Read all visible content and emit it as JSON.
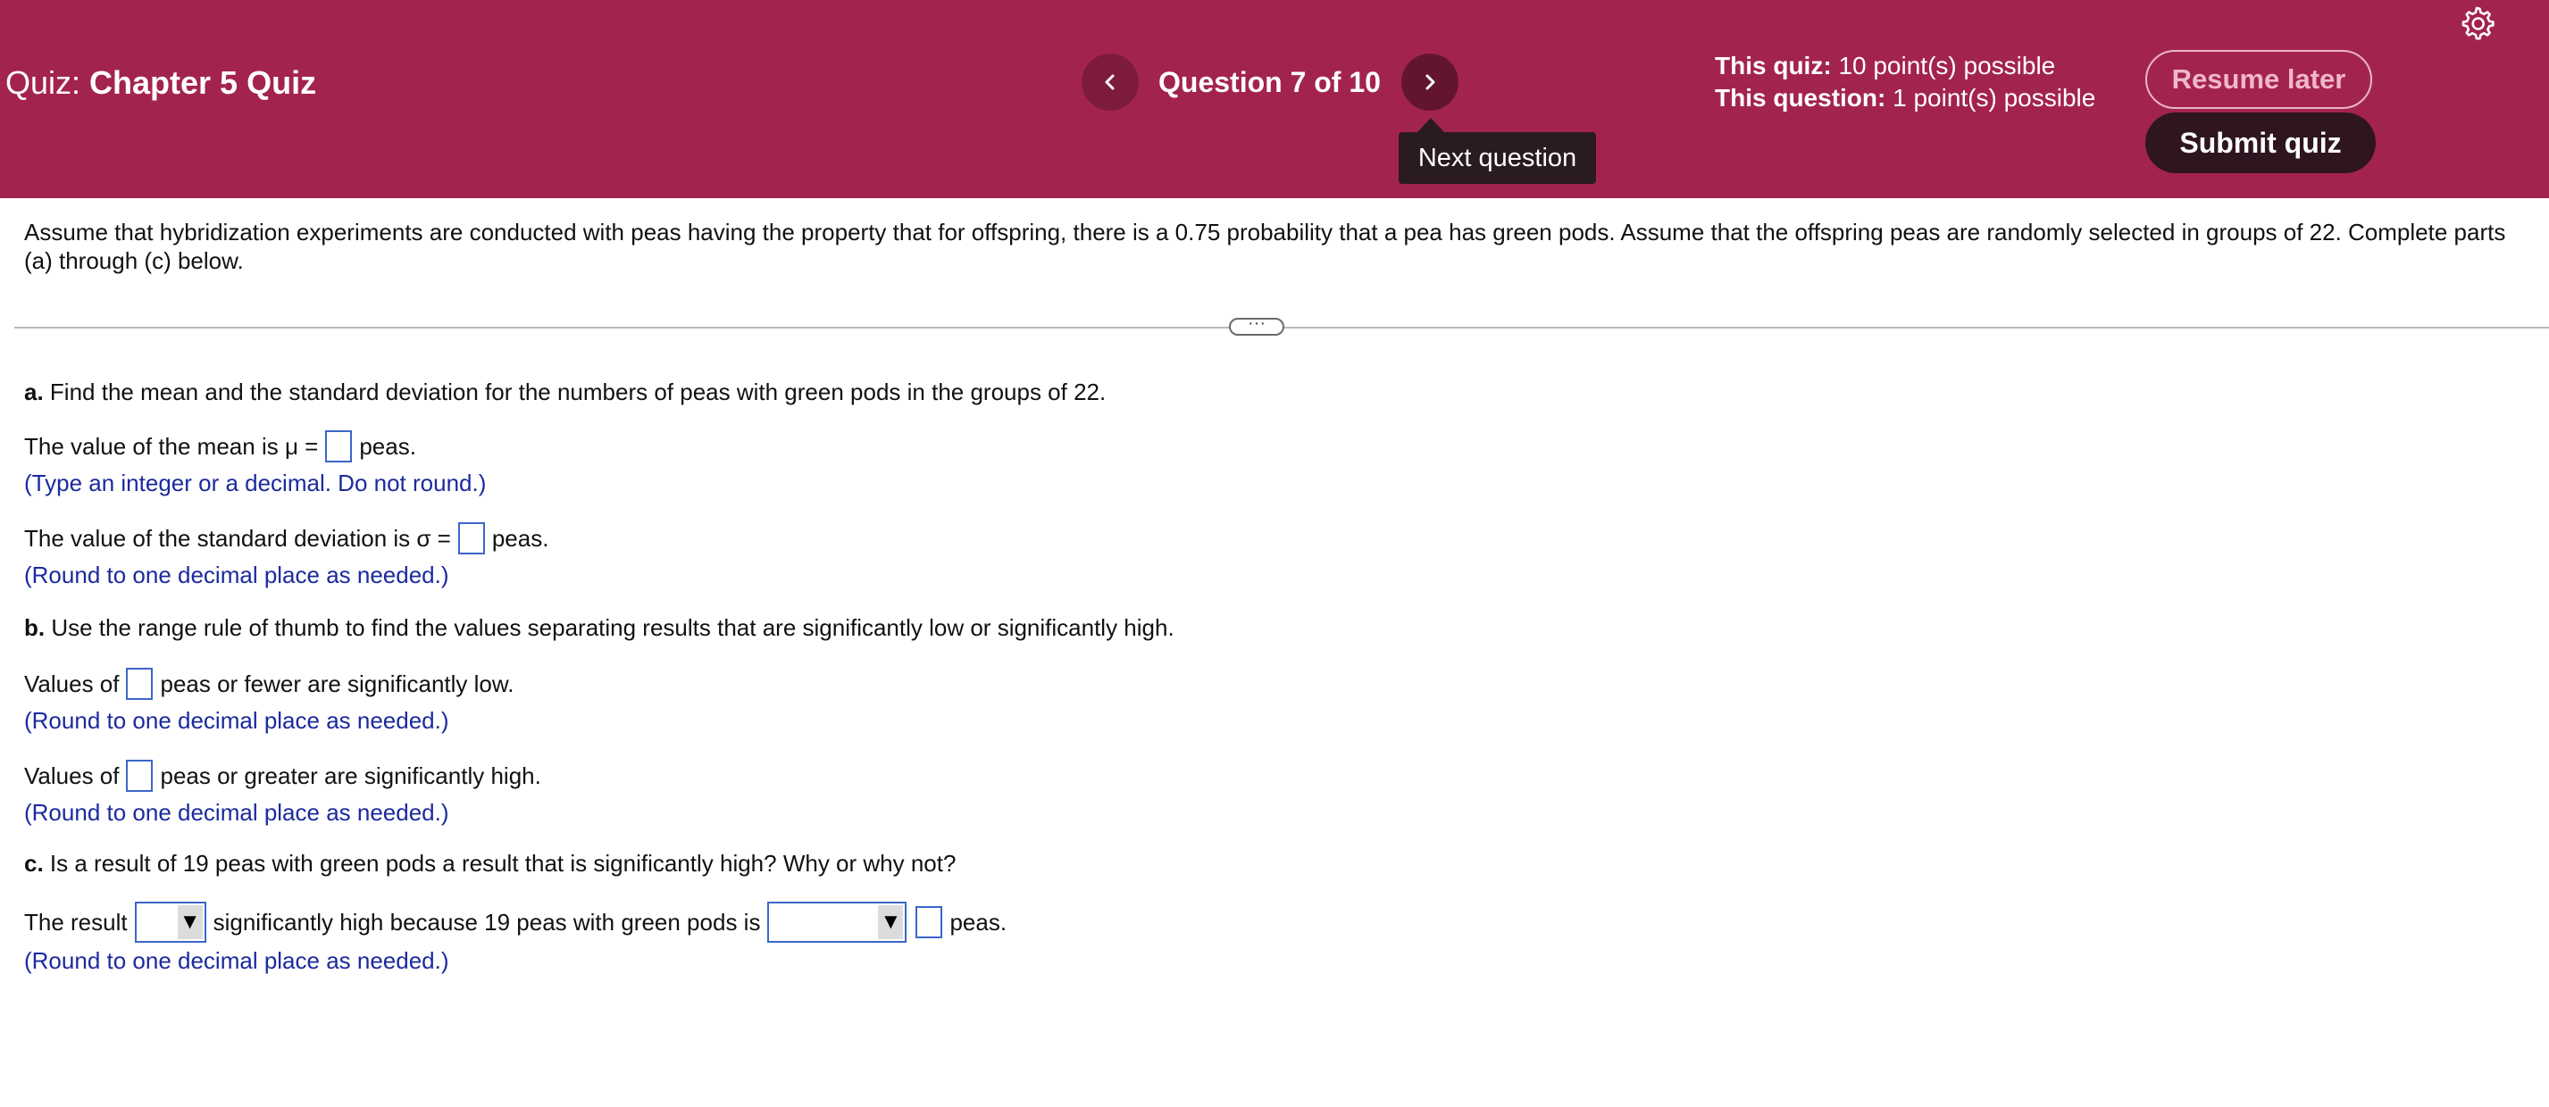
{
  "header": {
    "quiz_label": "Quiz:",
    "quiz_name": "Chapter 5 Quiz",
    "question_counter": "Question 7 of 10",
    "prev_glyph": "‹",
    "next_glyph": "›",
    "next_tooltip": "Next question",
    "quiz_points_label": "This quiz:",
    "quiz_points_value": "10 point(s) possible",
    "question_points_label": "This question:",
    "question_points_value": "1 point(s) possible",
    "resume_label": "Resume later",
    "submit_label": "Submit quiz",
    "settings_icon": "gear-icon",
    "colors": {
      "header_bg": "#a3234f",
      "submit_bg": "#2e1520",
      "hint_text": "#1b2a9e",
      "input_border": "#3b66c9"
    }
  },
  "question": {
    "stem": "Assume that hybridization experiments are conducted with peas having the property that for offspring, there is a 0.75 probability that a pea has green pods. Assume that the offspring peas are randomly selected in groups of 22. Complete parts (a) through (c) below.",
    "expand_glyph": "···",
    "part_a": {
      "label": "a.",
      "prompt": "Find the mean and the standard deviation for the numbers of peas with green pods in the groups of 22.",
      "mean_prefix": "The value of the mean is μ =",
      "mean_value": "",
      "mean_suffix": "peas.",
      "mean_hint": "(Type an integer or a decimal. Do not round.)",
      "sd_prefix": "The value of the standard deviation is σ =",
      "sd_value": "",
      "sd_suffix": "peas.",
      "sd_hint": "(Round to one decimal place as needed.)"
    },
    "part_b": {
      "label": "b.",
      "prompt": "Use the range rule of thumb to find the values separating results that are significantly low or significantly high.",
      "low_prefix": "Values of",
      "low_value": "",
      "low_suffix": "peas or fewer are significantly low.",
      "low_hint": "(Round to one decimal place as needed.)",
      "high_prefix": "Values of",
      "high_value": "",
      "high_suffix": "peas or greater are significantly high.",
      "high_hint": "(Round to one decimal place as needed.)"
    },
    "part_c": {
      "label": "c.",
      "prompt": "Is a result of 19 peas with green pods a result that is significantly high? Why or why not?",
      "prefix": "The result",
      "select1_value": "",
      "middle": "significantly high because 19 peas with green pods is",
      "select2_value": "",
      "box_value": "",
      "suffix": "peas.",
      "hint": "(Round to one decimal place as needed.)",
      "caret_glyph": "▼"
    }
  }
}
